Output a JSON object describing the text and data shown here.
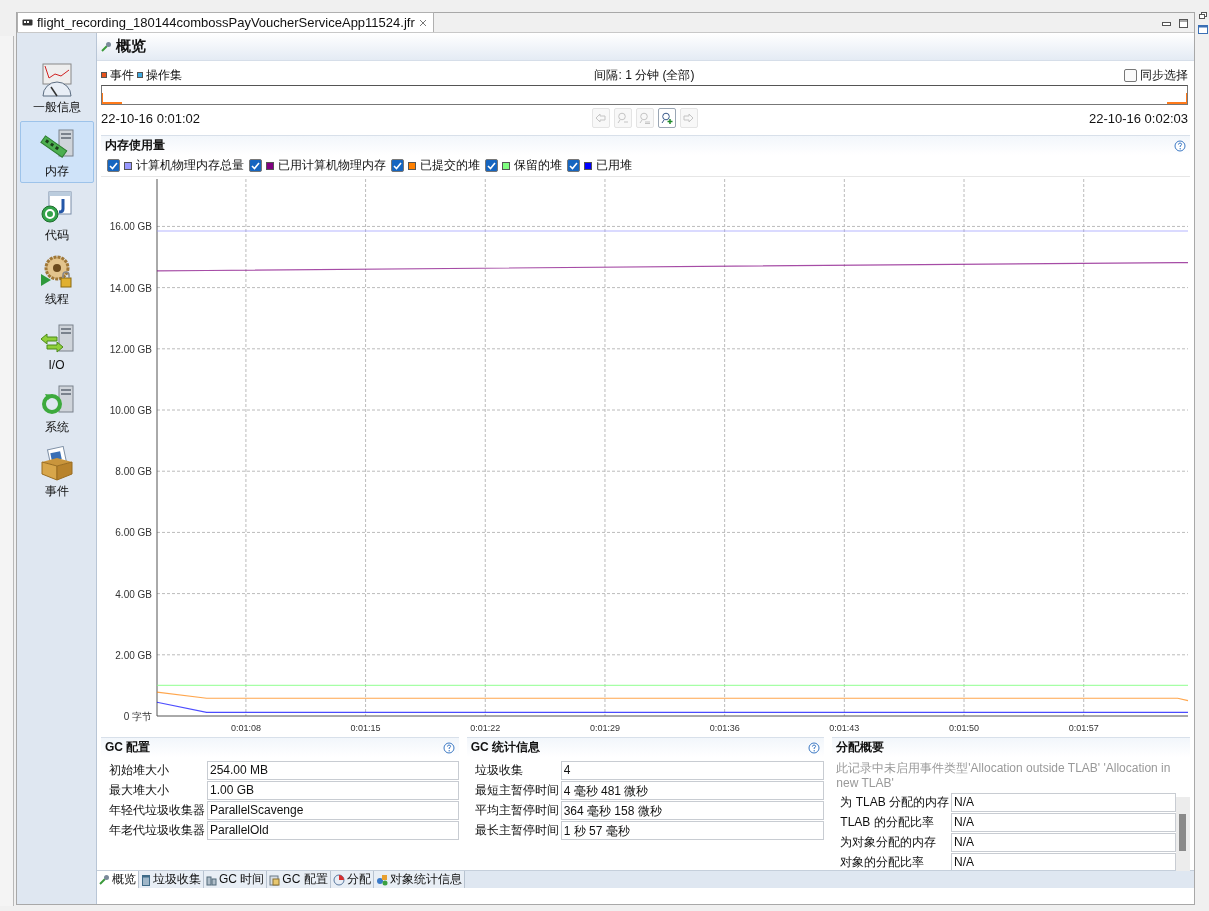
{
  "editor_tab": {
    "title": "flight_recording_180144combossPayVoucherServiceApp11524.jfr",
    "selected": true
  },
  "sidebar": {
    "items": [
      {
        "label": "一般信息",
        "kind": "general",
        "selected": false
      },
      {
        "label": "内存",
        "kind": "memory",
        "selected": true
      },
      {
        "label": "代码",
        "kind": "code",
        "selected": false
      },
      {
        "label": "线程",
        "kind": "threads",
        "selected": false
      },
      {
        "label": "I/O",
        "kind": "io",
        "selected": false
      },
      {
        "label": "系统",
        "kind": "system",
        "selected": false
      },
      {
        "label": "事件",
        "kind": "events",
        "selected": false
      }
    ]
  },
  "page": {
    "title": "概览"
  },
  "timeline": {
    "legend": [
      {
        "label": "事件",
        "color": "#e8531c"
      },
      {
        "label": "操作集",
        "color": "#3fa9e0"
      }
    ],
    "interval": "间隔: 1 分钟 (全部)",
    "sync": {
      "label": "同步选择",
      "checked": false
    },
    "start": "22-10-16 0:01:02",
    "end": "22-10-16 0:02:03",
    "nav_buttons": [
      {
        "kind": "back",
        "disabled": true
      },
      {
        "kind": "zoom-in",
        "disabled": true
      },
      {
        "kind": "zoom-out",
        "disabled": true
      },
      {
        "kind": "add",
        "disabled": false
      },
      {
        "kind": "forward",
        "disabled": true
      }
    ]
  },
  "memory_chart": {
    "title": "内存使用量",
    "legend": [
      {
        "checked": true
      },
      {
        "checked": true
      },
      {
        "checked": true
      },
      {
        "checked": true
      },
      {
        "checked": true
      }
    ],
    "chart_data": {
      "type": "line",
      "grid": true,
      "x": [
        62.8,
        65.7,
        122.5,
        123.1
      ],
      "series": [
        {
          "name": "计算机物理内存总量",
          "color": "#9999ff",
          "values": [
            15.85,
            15.85,
            15.85,
            15.85
          ]
        },
        {
          "name": "已用计算机物理内存",
          "color": "#800080",
          "values": [
            14.55,
            14.56,
            14.82,
            14.82
          ]
        },
        {
          "name": "已提交的堆",
          "color": "#ff8000",
          "values": [
            0.78,
            0.58,
            0.58,
            0.5
          ]
        },
        {
          "name": "保留的堆",
          "color": "#80ff80",
          "values": [
            1.0,
            1.0,
            1.0,
            1.0
          ]
        },
        {
          "name": "已用堆",
          "color": "#0000ff",
          "values": [
            0.45,
            0.12,
            0.12,
            0.12
          ]
        }
      ],
      "xlim": [
        62.8,
        123.1
      ],
      "ylim": [
        0,
        17.55
      ],
      "xticks": [
        {
          "value": 68,
          "label": "0:01:08"
        },
        {
          "value": 75,
          "label": "0:01:15"
        },
        {
          "value": 82,
          "label": "0:01:22"
        },
        {
          "value": 89,
          "label": "0:01:29"
        },
        {
          "value": 96,
          "label": "0:01:36"
        },
        {
          "value": 103,
          "label": "0:01:43"
        },
        {
          "value": 110,
          "label": "0:01:50"
        },
        {
          "value": 117,
          "label": "0:01:57"
        }
      ],
      "yticks": [
        {
          "value": 0,
          "label": "0 字节"
        },
        {
          "value": 2,
          "label": "2.00 GB"
        },
        {
          "value": 4,
          "label": "4.00 GB"
        },
        {
          "value": 6,
          "label": "6.00 GB"
        },
        {
          "value": 8,
          "label": "8.00 GB"
        },
        {
          "value": 10,
          "label": "10.00 GB"
        },
        {
          "value": 12,
          "label": "12.00 GB"
        },
        {
          "value": 14,
          "label": "14.00 GB"
        },
        {
          "value": 16,
          "label": "16.00 GB"
        }
      ]
    }
  },
  "gc_config": {
    "title": "GC 配置",
    "rows": [
      {
        "label": "初始堆大小",
        "value": "254.00 MB"
      },
      {
        "label": "最大堆大小",
        "value": "1.00 GB"
      },
      {
        "label": "年轻代垃圾收集器",
        "value": "ParallelScavenge"
      },
      {
        "label": "年老代垃圾收集器",
        "value": "ParallelOld"
      }
    ]
  },
  "gc_stats": {
    "title": "GC 统计信息",
    "rows": [
      {
        "label": "垃圾收集",
        "value": "4"
      },
      {
        "label": "最短主暂停时间",
        "value": "4 毫秒 481 微秒"
      },
      {
        "label": "平均主暂停时间",
        "value": "364 毫秒 158 微秒"
      },
      {
        "label": "最长主暂停时间",
        "value": "1 秒 57 毫秒"
      }
    ]
  },
  "allocation": {
    "title": "分配概要",
    "message": "此记录中未启用事件类型'Allocation outside TLAB' 'Allocation in new TLAB'",
    "rows": [
      {
        "label": "为 TLAB 分配的内存",
        "value": "N/A"
      },
      {
        "label": "TLAB 的分配比率",
        "value": "N/A"
      },
      {
        "label": "为对象分配的内存",
        "value": "N/A"
      },
      {
        "label": "对象的分配比率",
        "value": "N/A"
      }
    ]
  },
  "bottom_tabs": [
    {
      "label": "概览",
      "kind": "overview",
      "selected": true
    },
    {
      "label": "垃圾收集",
      "kind": "trash",
      "selected": false
    },
    {
      "label": "GC 时间",
      "kind": "time",
      "selected": false
    },
    {
      "label": "GC 配置",
      "kind": "config",
      "selected": false
    },
    {
      "label": "分配",
      "kind": "pie",
      "selected": false
    },
    {
      "label": "对象统计信息",
      "kind": "objects",
      "selected": false
    }
  ]
}
